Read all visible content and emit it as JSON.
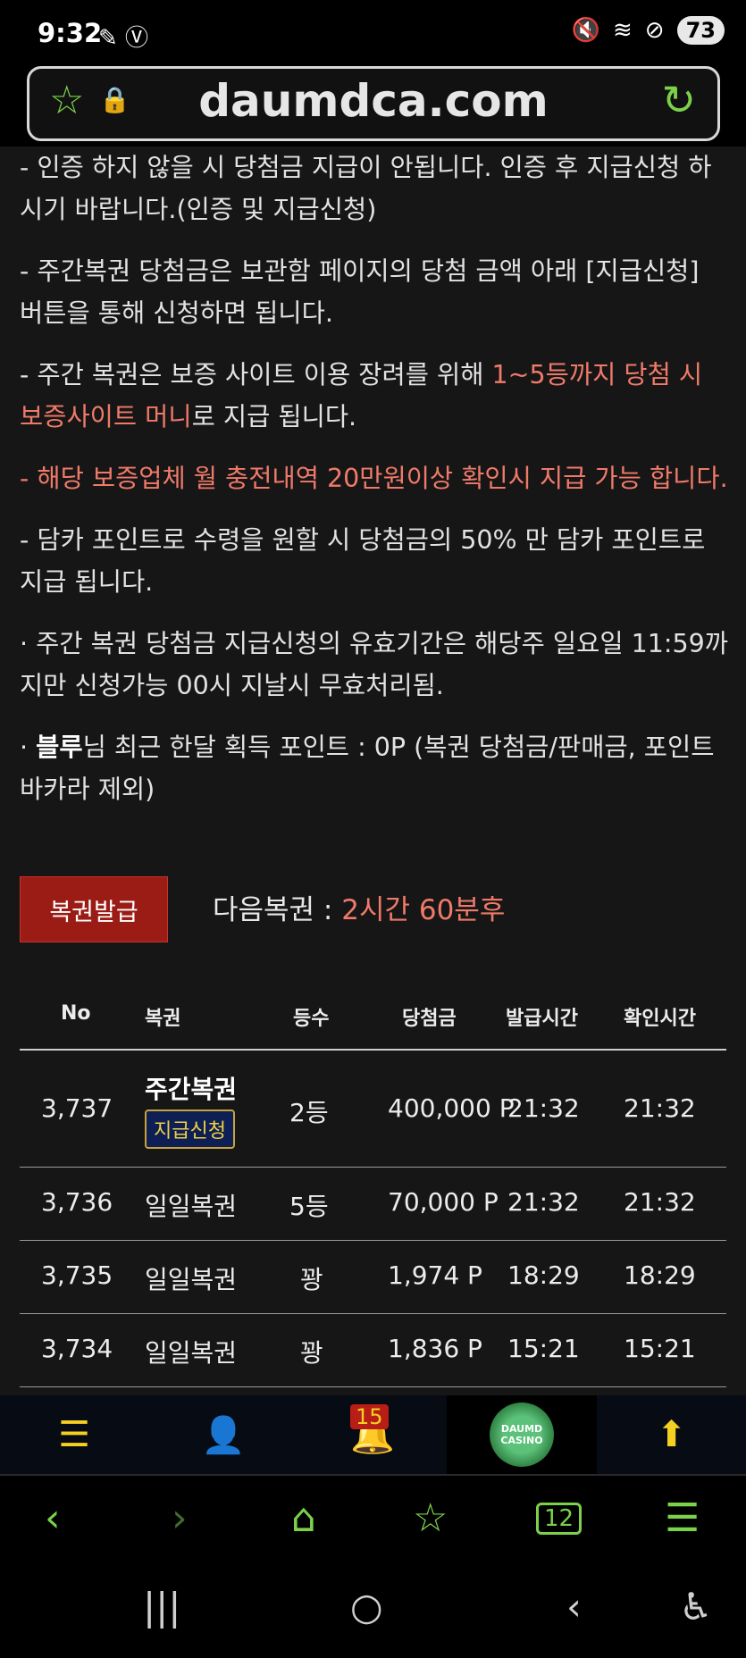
{
  "status_bar": {
    "time": "9:32",
    "battery": "73"
  },
  "browser": {
    "url": "daumdca.com"
  },
  "notes": [
    {
      "parts": [
        {
          "t": "- 인증 하지 않을 시 당첨금 지급이 안됩니다. 인증 후 지급신청 하시기 바랍니다.(인증 및 지급신청)",
          "c": ""
        }
      ]
    },
    {
      "parts": [
        {
          "t": "- 주간복권 당첨금은 보관함 페이지의 당첨 금액 아래 [지급신청] 버튼을 통해 신청하면 됩니다.",
          "c": ""
        }
      ]
    },
    {
      "parts": [
        {
          "t": "- 주간 복권은 보증 사이트 이용 장려를 위해 ",
          "c": ""
        },
        {
          "t": "1~5등까지 당첨 시 보증사이트 머니",
          "c": "red"
        },
        {
          "t": "로 지급 됩니다.",
          "c": ""
        }
      ]
    },
    {
      "parts": [
        {
          "t": "- ",
          "c": "red"
        },
        {
          "t": "해당 보증업체 월 충전내역 20만원이상 확인시 지급 가능 합니다.",
          "c": "red"
        }
      ]
    },
    {
      "parts": [
        {
          "t": "- 담카 포인트로 수령을 원할 시 당첨금의 50% 만 담카 포인트로 지급 됩니다.",
          "c": ""
        }
      ]
    },
    {
      "parts": [
        {
          "t": "· 주간 복권 당첨금 지급신청의 유효기간은 해당주 일요일 11:59까지만 신청가능 00시 지날시 무효처리됨.",
          "c": ""
        }
      ]
    },
    {
      "parts": [
        {
          "t": "· ",
          "c": ""
        },
        {
          "t": "블루",
          "c": "bold"
        },
        {
          "t": "님 최근 한달 획득 포인트 : 0P (복권 당첨금/판매금, 포인트 바카라 제외)",
          "c": ""
        }
      ]
    }
  ],
  "issue_button": "복권발급",
  "next_lottery": {
    "label": "다음복권 : ",
    "value": "2시간 60분후"
  },
  "table": {
    "headers": {
      "no": "No",
      "lottery": "복권",
      "rank": "등수",
      "prize": "당첨금",
      "issued": "발급시간",
      "checked": "확인시간"
    },
    "rows": [
      {
        "no": "3,737",
        "lottery": "주간복권",
        "badge": "지급신청",
        "rank": "2등",
        "prize": "400,000 P",
        "issued": "21:32",
        "checked": "21:32"
      },
      {
        "no": "3,736",
        "lottery": "일일복권",
        "rank": "5등",
        "prize": "70,000 P",
        "issued": "21:32",
        "checked": "21:32"
      },
      {
        "no": "3,735",
        "lottery": "일일복권",
        "rank": "꽝",
        "prize": "1,974 P",
        "issued": "18:29",
        "checked": "18:29"
      },
      {
        "no": "3,734",
        "lottery": "일일복권",
        "rank": "꽝",
        "prize": "1,836 P",
        "issued": "15:21",
        "checked": "15:21"
      }
    ]
  },
  "bottom_nav": {
    "notification_count": "15",
    "casino_logo_text": "DAUMD CASINO"
  },
  "browser_toolbar": {
    "tabs_count": "12"
  },
  "colors": {
    "accent_red": "#f07a6a",
    "nav_yellow": "#f5d020",
    "browser_green": "#7bd14a",
    "button_red": "#9b1c14"
  }
}
